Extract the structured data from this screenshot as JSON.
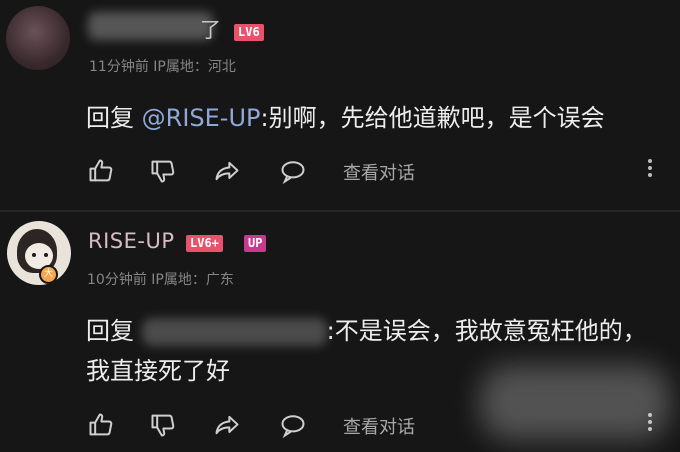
{
  "comments": [
    {
      "author_suffix": "了",
      "level_badge": "LV6",
      "meta": "11分钟前 IP属地：河北",
      "reply_prefix": "回复 ",
      "mention": "@RISE-UP",
      "reply_text": ":别啊，先给他道歉吧，是个误会",
      "view_conversation": "查看对话"
    },
    {
      "author": "RISE-UP",
      "level_badge": "LV6+",
      "up_badge": "UP",
      "verified_glyph": "大",
      "meta": "10分钟前 IP属地：广东",
      "reply_prefix": "回复 ",
      "reply_text": ":不是误会，我故意冤枉他的，我直接死了好",
      "view_conversation": "查看对话"
    }
  ],
  "icons": [
    "thumb-up-icon",
    "thumb-down-icon",
    "share-icon",
    "comment-icon",
    "more-vertical-icon"
  ],
  "colors": {
    "background": "#161616",
    "level_badge": "#e8526b",
    "up_badge": "#c93a8e",
    "mention": "#8fa8d6",
    "up_name": "#d8bcc4"
  }
}
